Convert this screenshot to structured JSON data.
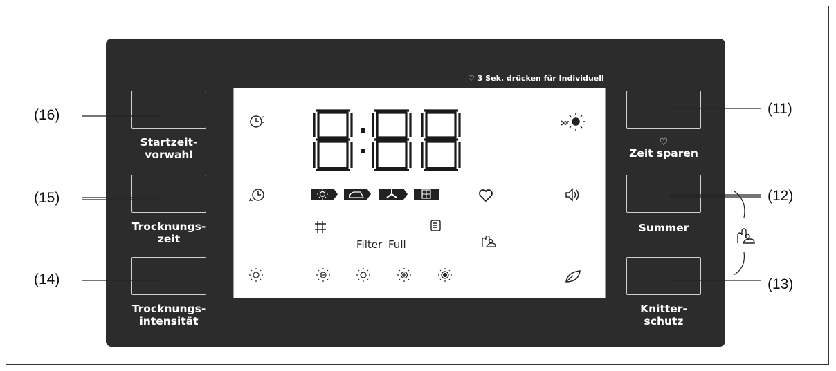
{
  "callouts": [
    "(16)",
    "(15)",
    "(14)",
    "(11)",
    "(12)",
    "(13)"
  ],
  "buttons": {
    "startzeit": {
      "line1": "Startzeit-",
      "line2": "vorwahl"
    },
    "trocknungszeit": {
      "line1": "Trocknungs-",
      "line2": "zeit"
    },
    "intensitaet": {
      "line1": "Trocknungs-",
      "line2": "intensität"
    },
    "zeit_sparen": {
      "label": "Zeit sparen",
      "icon": "heart-icon"
    },
    "summer": {
      "label": "Summer"
    },
    "knitterschutz": {
      "line1": "Knitter-",
      "line2": "schutz"
    }
  },
  "hint": "3 Sek. drücken für Individuell",
  "display": {
    "time": "8:88",
    "status_labels": [
      "Filter",
      "Full"
    ],
    "icons": [
      "clock-start-icon",
      "clock-duration-icon",
      "sun-icon",
      "sun-arrows-icon",
      "speaker-icon",
      "leaf-icon",
      "heart-icon",
      "child-lock-icon",
      "grid-icon",
      "tank-icon",
      "iron-icon",
      "fan-icon",
      "window-icon"
    ]
  }
}
